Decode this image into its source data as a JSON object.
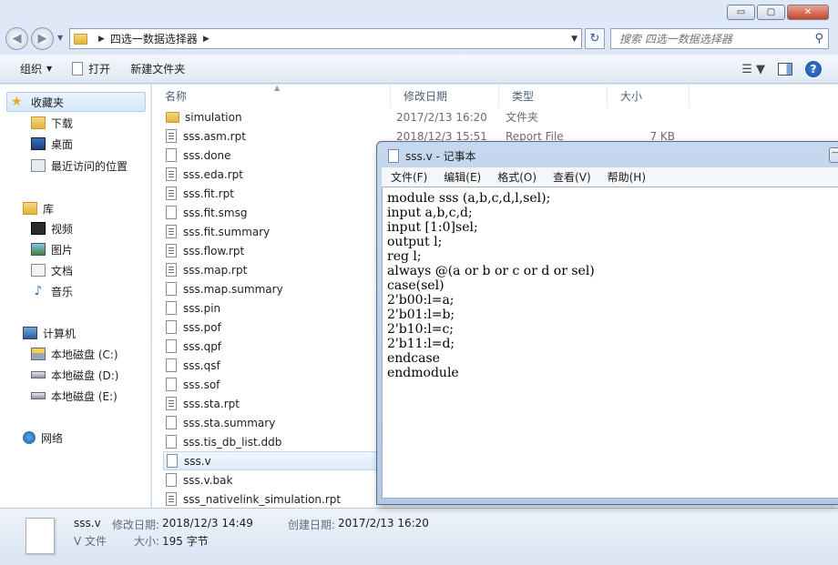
{
  "explorer": {
    "window_controls": {
      "minimize": "▭",
      "maximize": "▢",
      "close": "✕"
    },
    "address": {
      "crumbs": [
        "四选一数据选择器"
      ]
    },
    "search": {
      "placeholder": "搜索 四选一数据选择器"
    },
    "toolbar": {
      "organize": "组织",
      "open": "打开",
      "new_folder": "新建文件夹"
    },
    "nav": {
      "favorites": {
        "label": "收藏夹",
        "items": [
          "下载",
          "桌面",
          "最近访问的位置"
        ]
      },
      "libraries": {
        "label": "库",
        "items": [
          "视频",
          "图片",
          "文档",
          "音乐"
        ]
      },
      "computer": {
        "label": "计算机",
        "items": [
          "本地磁盘 (C:)",
          "本地磁盘 (D:)",
          "本地磁盘 (E:)"
        ]
      },
      "network": {
        "label": "网络"
      }
    },
    "columns": {
      "name": "名称",
      "date": "修改日期",
      "type": "类型",
      "size": "大小"
    },
    "files": [
      {
        "name": "simulation",
        "date": "2017/2/13 16:20",
        "type": "文件夹",
        "size": "",
        "kind": "folder"
      },
      {
        "name": "sss.asm.rpt",
        "date": "2018/12/3 15:51",
        "type": "Report File",
        "size": "7 KB",
        "kind": "text"
      },
      {
        "name": "sss.done",
        "kind": "blank"
      },
      {
        "name": "sss.eda.rpt",
        "kind": "text"
      },
      {
        "name": "sss.fit.rpt",
        "kind": "text"
      },
      {
        "name": "sss.fit.smsg",
        "kind": "blank"
      },
      {
        "name": "sss.fit.summary",
        "kind": "text"
      },
      {
        "name": "sss.flow.rpt",
        "kind": "text"
      },
      {
        "name": "sss.map.rpt",
        "kind": "text"
      },
      {
        "name": "sss.map.summary",
        "kind": "blank"
      },
      {
        "name": "sss.pin",
        "kind": "blank"
      },
      {
        "name": "sss.pof",
        "kind": "blank"
      },
      {
        "name": "sss.qpf",
        "kind": "blank"
      },
      {
        "name": "sss.qsf",
        "kind": "blank"
      },
      {
        "name": "sss.sof",
        "kind": "blank"
      },
      {
        "name": "sss.sta.rpt",
        "kind": "text"
      },
      {
        "name": "sss.sta.summary",
        "kind": "blank"
      },
      {
        "name": "sss.tis_db_list.ddb",
        "kind": "blank"
      },
      {
        "name": "sss.v",
        "kind": "blank",
        "selected": true
      },
      {
        "name": "sss.v.bak",
        "kind": "blank"
      },
      {
        "name": "sss_nativelink_simulation.rpt",
        "kind": "text"
      }
    ],
    "status": {
      "file_name": "sss.v",
      "file_type": "V 文件",
      "modified_label": "修改日期:",
      "modified_value": "2018/12/3 14:49",
      "size_label": "大小:",
      "size_value": "195 字节",
      "created_label": "创建日期:",
      "created_value": "2017/2/13 16:20"
    }
  },
  "notepad": {
    "title": "sss.v - 记事本",
    "menu": [
      "文件(F)",
      "编辑(E)",
      "格式(O)",
      "查看(V)",
      "帮助(H)"
    ],
    "lines": [
      "module sss (a,b,c,d,l,sel);",
      "input a,b,c,d;",
      "input [1:0]sel;",
      "output l;",
      "reg l;",
      "always @(a or b or c or d or sel)",
      "case(sel)",
      "2'b00:l=a;",
      "2'b01:l=b;",
      "2'b10:l=c;",
      "2'b11:l=d;",
      "endcase",
      "endmodule"
    ]
  }
}
